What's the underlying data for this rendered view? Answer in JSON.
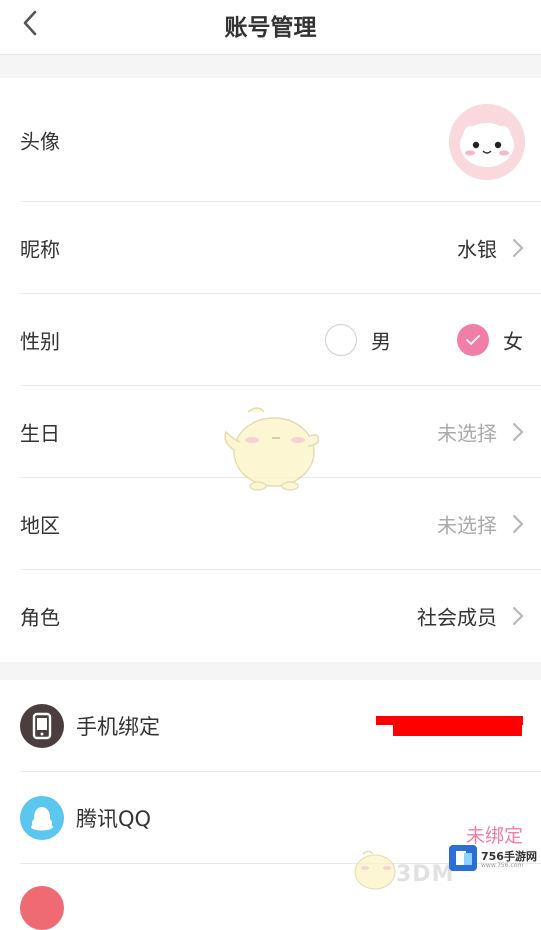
{
  "header": {
    "title": "账号管理"
  },
  "profile": {
    "avatar_label": "头像",
    "nickname_label": "昵称",
    "nickname_value": "水银",
    "gender_label": "性别",
    "gender_options": [
      {
        "label": "男",
        "selected": false
      },
      {
        "label": "女",
        "selected": true
      }
    ],
    "birthday_label": "生日",
    "birthday_value": "未选择",
    "region_label": "地区",
    "region_value": "未选择",
    "role_label": "角色",
    "role_value": "社会成员"
  },
  "bindings": {
    "phone_label": "手机绑定",
    "qq_label": "腾讯QQ",
    "qq_status": "未绑定"
  },
  "watermark": {
    "site_name": "756手游网",
    "site_url": "www.756.com",
    "brand_text": "3DM"
  },
  "colors": {
    "accent_pink": "#f17ea6",
    "divider": "#eaeaea",
    "section_gap": "#f5f5f5",
    "phone_icon_bg": "#4a3e3e",
    "qq_icon_bg": "#5bc6f0",
    "redaction": "#ff0000"
  },
  "icons": [
    "back-arrow-icon",
    "chevron-right-icon",
    "checkmark-icon",
    "phone-icon",
    "qq-penguin-icon"
  ]
}
